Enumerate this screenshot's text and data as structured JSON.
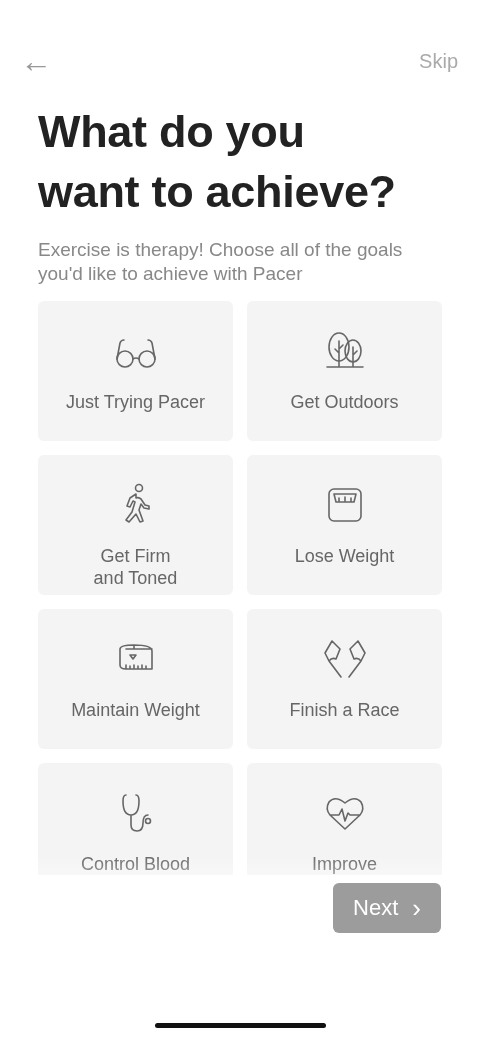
{
  "header": {
    "back": "←",
    "skip": "Skip"
  },
  "title": "What do you\nwant to achieve?",
  "subtitle": "Exercise is therapy! Choose all of the goals you'd like to achieve with Pacer",
  "goals": [
    {
      "label": "Just Trying Pacer",
      "selected": false
    },
    {
      "label": "Get Outdoors",
      "selected": false
    },
    {
      "label": "Get Firm\nand Toned",
      "selected": false
    },
    {
      "label": "Lose Weight",
      "selected": false
    },
    {
      "label": "Maintain Weight",
      "selected": false
    },
    {
      "label": "Finish a Race",
      "selected": false
    },
    {
      "label": "Control Blood",
      "selected": false
    },
    {
      "label": "Improve",
      "selected": false
    }
  ],
  "next_button": {
    "label": "Next",
    "chevron": "›",
    "disabled": true
  }
}
